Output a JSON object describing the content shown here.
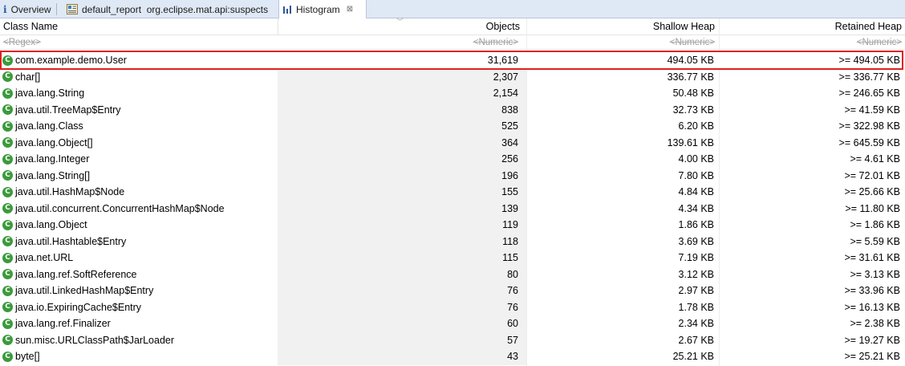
{
  "tabs": [
    {
      "label": "Overview",
      "icon": "info-icon"
    },
    {
      "label": "default_report  org.eclipse.mat.api:suspects",
      "icon": "report-icon"
    },
    {
      "label": "Histogram",
      "icon": "histogram-icon",
      "close": "⊠"
    }
  ],
  "columns": {
    "class_name": "Class Name",
    "objects": "Objects",
    "shallow_heap": "Shallow Heap",
    "retained_heap": "Retained Heap"
  },
  "filters": {
    "class_name": "<Regex>",
    "objects": "<Numeric>",
    "shallow_heap": "<Numeric>",
    "retained_heap": "<Numeric>"
  },
  "class_icon_letter": "C",
  "rows": [
    {
      "name": "com.example.demo.User",
      "objects": "31,619",
      "shallow": "494.05 KB",
      "retained": ">= 494.05 KB"
    },
    {
      "name": "char[]",
      "objects": "2,307",
      "shallow": "336.77 KB",
      "retained": ">= 336.77 KB"
    },
    {
      "name": "java.lang.String",
      "objects": "2,154",
      "shallow": "50.48 KB",
      "retained": ">= 246.65 KB"
    },
    {
      "name": "java.util.TreeMap$Entry",
      "objects": "838",
      "shallow": "32.73 KB",
      "retained": ">= 41.59 KB"
    },
    {
      "name": "java.lang.Class",
      "objects": "525",
      "shallow": "6.20 KB",
      "retained": ">= 322.98 KB"
    },
    {
      "name": "java.lang.Object[]",
      "objects": "364",
      "shallow": "139.61 KB",
      "retained": ">= 645.59 KB"
    },
    {
      "name": "java.lang.Integer",
      "objects": "256",
      "shallow": "4.00 KB",
      "retained": ">= 4.61 KB"
    },
    {
      "name": "java.lang.String[]",
      "objects": "196",
      "shallow": "7.80 KB",
      "retained": ">= 72.01 KB"
    },
    {
      "name": "java.util.HashMap$Node",
      "objects": "155",
      "shallow": "4.84 KB",
      "retained": ">= 25.66 KB"
    },
    {
      "name": "java.util.concurrent.ConcurrentHashMap$Node",
      "objects": "139",
      "shallow": "4.34 KB",
      "retained": ">= 11.80 KB"
    },
    {
      "name": "java.lang.Object",
      "objects": "119",
      "shallow": "1.86 KB",
      "retained": ">= 1.86 KB"
    },
    {
      "name": "java.util.Hashtable$Entry",
      "objects": "118",
      "shallow": "3.69 KB",
      "retained": ">= 5.59 KB"
    },
    {
      "name": "java.net.URL",
      "objects": "115",
      "shallow": "7.19 KB",
      "retained": ">= 31.61 KB"
    },
    {
      "name": "java.lang.ref.SoftReference",
      "objects": "80",
      "shallow": "3.12 KB",
      "retained": ">= 3.13 KB"
    },
    {
      "name": "java.util.LinkedHashMap$Entry",
      "objects": "76",
      "shallow": "2.97 KB",
      "retained": ">= 33.96 KB"
    },
    {
      "name": "java.io.ExpiringCache$Entry",
      "objects": "76",
      "shallow": "1.78 KB",
      "retained": ">= 16.13 KB"
    },
    {
      "name": "java.lang.ref.Finalizer",
      "objects": "60",
      "shallow": "2.34 KB",
      "retained": ">= 2.38 KB"
    },
    {
      "name": "sun.misc.URLClassPath$JarLoader",
      "objects": "57",
      "shallow": "2.67 KB",
      "retained": ">= 19.27 KB"
    },
    {
      "name": "byte[]",
      "objects": "43",
      "shallow": "25.21 KB",
      "retained": ">= 25.21 KB"
    }
  ],
  "highlight_color": "#e0201f",
  "class_icon_color": "#3b9a3b"
}
